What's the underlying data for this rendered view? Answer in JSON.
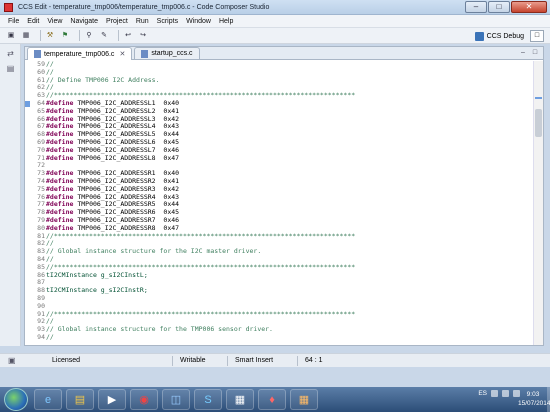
{
  "window": {
    "title": "CCS Edit - temperature_tmp006/temperature_tmp006.c - Code Composer Studio"
  },
  "menu": [
    "File",
    "Edit",
    "View",
    "Navigate",
    "Project",
    "Run",
    "Scripts",
    "Window",
    "Help"
  ],
  "toolbar": {
    "perspective_label": "CCS Debug"
  },
  "tabs": [
    {
      "label": "temperature_tmp006.c",
      "active": true
    },
    {
      "label": "startup_ccs.c",
      "active": false
    }
  ],
  "code_lines": [
    {
      "num": "59",
      "text": "//",
      "kind": "comment"
    },
    {
      "num": "60",
      "text": "//",
      "kind": "comment"
    },
    {
      "num": "61",
      "text": "// Define TMP006 I2C Address.",
      "kind": "comment"
    },
    {
      "num": "62",
      "text": "//",
      "kind": "comment"
    },
    {
      "num": "63",
      "text": "//*****************************************************************************",
      "kind": "comment"
    },
    {
      "num": "64",
      "text": "TMP006_I2C_ADDRESSL1  0x40",
      "kind": "define",
      "marker": true
    },
    {
      "num": "65",
      "text": "TMP006_I2C_ADDRESSL2  0x41",
      "kind": "define"
    },
    {
      "num": "66",
      "text": "TMP006_I2C_ADDRESSL3  0x42",
      "kind": "define"
    },
    {
      "num": "67",
      "text": "TMP006_I2C_ADDRESSL4  0x43",
      "kind": "define"
    },
    {
      "num": "68",
      "text": "TMP006_I2C_ADDRESSL5  0x44",
      "kind": "define"
    },
    {
      "num": "69",
      "text": "TMP006_I2C_ADDRESSL6  0x45",
      "kind": "define"
    },
    {
      "num": "70",
      "text": "TMP006_I2C_ADDRESSL7  0x46",
      "kind": "define"
    },
    {
      "num": "71",
      "text": "TMP006_I2C_ADDRESSL8  0x47",
      "kind": "define"
    },
    {
      "num": "72",
      "text": "",
      "kind": "plain"
    },
    {
      "num": "73",
      "text": "TMP006_I2C_ADDRESSR1  0x40",
      "kind": "define"
    },
    {
      "num": "74",
      "text": "TMP006_I2C_ADDRESSR2  0x41",
      "kind": "define"
    },
    {
      "num": "75",
      "text": "TMP006_I2C_ADDRESSR3  0x42",
      "kind": "define"
    },
    {
      "num": "76",
      "text": "TMP006_I2C_ADDRESSR4  0x43",
      "kind": "define"
    },
    {
      "num": "77",
      "text": "TMP006_I2C_ADDRESSR5  0x44",
      "kind": "define"
    },
    {
      "num": "78",
      "text": "TMP006_I2C_ADDRESSR6  0x45",
      "kind": "define"
    },
    {
      "num": "79",
      "text": "TMP006_I2C_ADDRESSR7  0x46",
      "kind": "define"
    },
    {
      "num": "80",
      "text": "TMP006_I2C_ADDRESSR8  0x47",
      "kind": "define"
    },
    {
      "num": "81",
      "text": "//*****************************************************************************",
      "kind": "comment"
    },
    {
      "num": "82",
      "text": "//",
      "kind": "comment"
    },
    {
      "num": "83",
      "text": "// Global instance structure for the I2C master driver.",
      "kind": "comment"
    },
    {
      "num": "84",
      "text": "//",
      "kind": "comment"
    },
    {
      "num": "85",
      "text": "//*****************************************************************************",
      "kind": "comment"
    },
    {
      "num": "86",
      "text": "tI2CMInstance g_sI2CInstL;",
      "kind": "type"
    },
    {
      "num": "87",
      "text": "",
      "kind": "plain"
    },
    {
      "num": "88",
      "text": "tI2CMInstance g_sI2CInstR;",
      "kind": "type"
    },
    {
      "num": "89",
      "text": "",
      "kind": "plain"
    },
    {
      "num": "90",
      "text": "",
      "kind": "plain"
    },
    {
      "num": "91",
      "text": "//*****************************************************************************",
      "kind": "comment"
    },
    {
      "num": "92",
      "text": "//",
      "kind": "comment"
    },
    {
      "num": "93",
      "text": "// Global instance structure for the TMP006 sensor driver.",
      "kind": "comment"
    },
    {
      "num": "94",
      "text": "//",
      "kind": "comment"
    }
  ],
  "define_keyword": "#define",
  "statusbar": {
    "licensed": "Licensed",
    "writable": "Writable",
    "insert_mode": "Smart Insert",
    "position": "64 : 1"
  },
  "taskbar": {
    "lang": "ES",
    "time": "9:03",
    "date": "15/07/2014"
  },
  "colors": {
    "comment": "#3f7f5f",
    "preprocessor": "#7f0055",
    "accent": "#6e9ee0"
  }
}
